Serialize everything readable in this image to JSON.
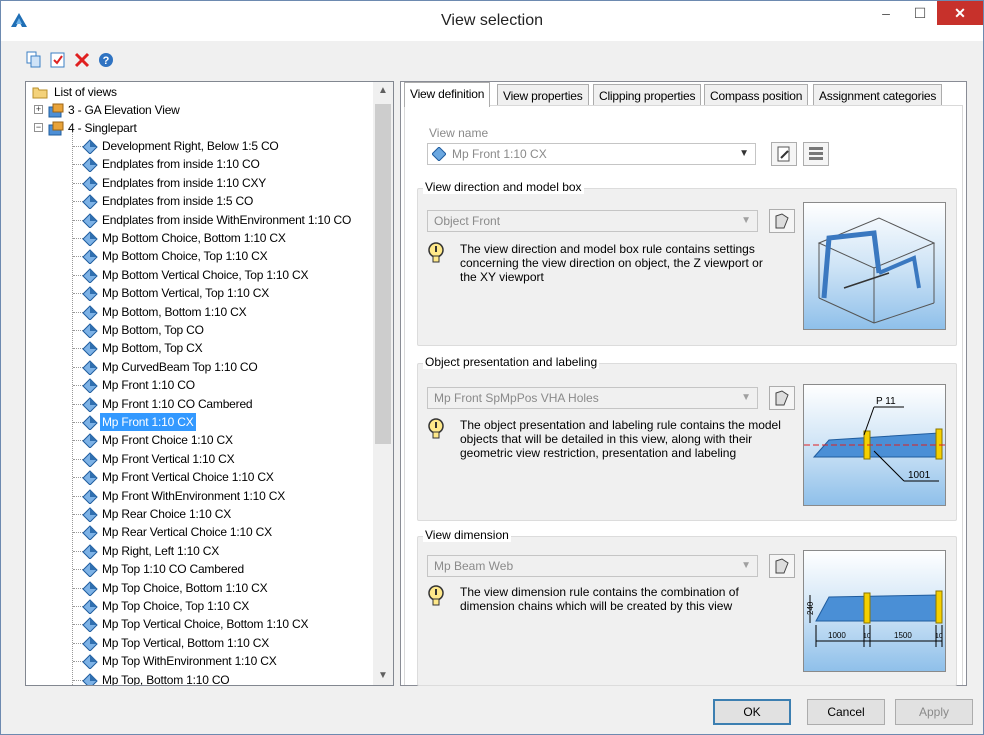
{
  "window": {
    "title": "View selection",
    "min": "–",
    "max": "☐",
    "close": "✕"
  },
  "toolbar": {
    "icons": [
      "copy-icon",
      "checklist-icon",
      "delete-icon",
      "help-icon"
    ]
  },
  "tree": {
    "root": "List of views",
    "nodes": [
      "3 - GA Elevation View",
      "4 - Singlepart"
    ],
    "items": [
      "Development Right, Below 1:5 CO",
      "Endplates from inside 1:10 CO",
      "Endplates from inside 1:10 CXY",
      "Endplates from inside 1:5 CO",
      "Endplates from inside WithEnvironment 1:10 CO",
      "Mp Bottom Choice, Bottom 1:10 CX",
      "Mp Bottom Choice, Top 1:10 CX",
      "Mp Bottom Vertical Choice, Top 1:10 CX",
      "Mp Bottom Vertical, Top 1:10 CX",
      "Mp Bottom, Bottom 1:10 CX",
      "Mp Bottom, Top CO",
      "Mp Bottom, Top CX",
      "Mp CurvedBeam Top 1:10 CO",
      "Mp Front 1:10 CO",
      "Mp Front 1:10 CO Cambered",
      "Mp Front 1:10 CX",
      "Mp Front Choice 1:10 CX",
      "Mp Front Vertical 1:10 CX",
      "Mp Front Vertical Choice 1:10 CX",
      "Mp Front WithEnvironment 1:10 CX",
      "Mp Rear Choice 1:10 CX",
      "Mp Rear Vertical Choice 1:10 CX",
      "Mp Right, Left 1:10 CX",
      "Mp Top 1:10 CO Cambered",
      "Mp Top Choice, Bottom 1:10 CX",
      "Mp Top Choice, Top 1:10 CX",
      "Mp Top Vertical Choice, Bottom 1:10 CX",
      "Mp Top Vertical, Bottom 1:10 CX",
      "Mp Top WithEnvironment 1:10 CX",
      "Mp Top, Bottom 1:10 CO"
    ],
    "selected": "Mp Front 1:10 CX"
  },
  "tabs": [
    "View definition",
    "View properties",
    "Clipping properties",
    "Compass position",
    "Assignment categories"
  ],
  "view_definition": {
    "view_name_label": "View name",
    "view_name_value": "Mp Front 1:10 CX",
    "direction": {
      "title": "View direction and model box",
      "value": "Object Front",
      "info": "The view direction and model box rule contains settings concerning the view direction on object, the Z viewport or the XY viewport"
    },
    "presentation": {
      "title": "Object presentation and labeling",
      "value": "Mp Front SpMpPos VHA Holes",
      "info": "The object presentation and labeling rule contains the model objects that will be detailed in this view, along with their geometric view restriction, presentation and labeling",
      "pic_label_top": "P 11",
      "pic_label_bottom": "1001"
    },
    "dimension": {
      "title": "View dimension",
      "value": "Mp Beam Web",
      "info": "The view dimension rule contains the combination of dimension chains which will be created by this view",
      "dims": [
        "1000",
        "10",
        "1500",
        "10"
      ],
      "height_dim": "240"
    }
  },
  "buttons": {
    "ok": "OK",
    "cancel": "Cancel",
    "apply": "Apply"
  },
  "colors": {
    "selection": "#3399ff",
    "close": "#c7312b",
    "steel": "#2f6fb0"
  }
}
